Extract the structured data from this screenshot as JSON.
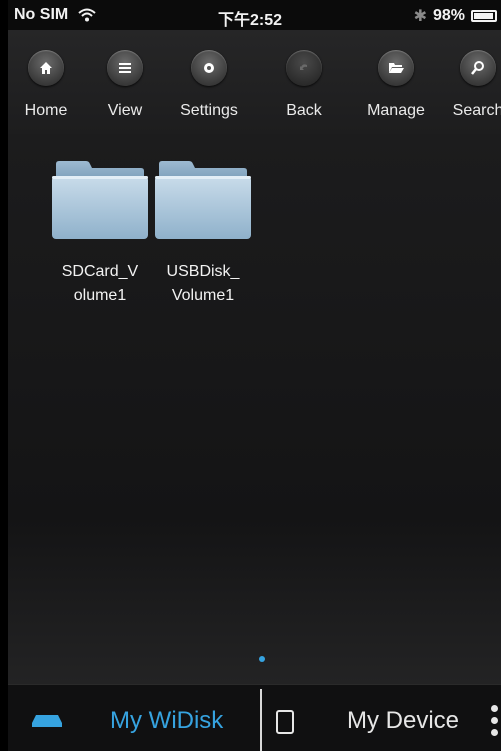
{
  "status_bar": {
    "carrier": "No SIM",
    "time": "下午2:52",
    "battery": "98%"
  },
  "toolbar": {
    "items": [
      {
        "label": "Home",
        "icon": "home-icon"
      },
      {
        "label": "View",
        "icon": "list-icon"
      },
      {
        "label": "Settings",
        "icon": "gear-icon"
      },
      {
        "label": "Back",
        "icon": "undo-icon"
      },
      {
        "label": "Manage",
        "icon": "folder-open-icon"
      },
      {
        "label": "Search",
        "icon": "search-icon"
      }
    ]
  },
  "folders": [
    {
      "name": "SDCard_Volume1",
      "line1": "SDCard_V",
      "line2": "olume1"
    },
    {
      "name": "USBDisk_Volume1",
      "line1": "USBDisk_",
      "line2": "Volume1"
    }
  ],
  "bottom_tabs": {
    "widisk_label": "My WiDisk",
    "device_label": "My Device"
  },
  "colors": {
    "accent": "#36a3e0",
    "background": "#1a1a1b",
    "folder": "#a9c6dc"
  }
}
